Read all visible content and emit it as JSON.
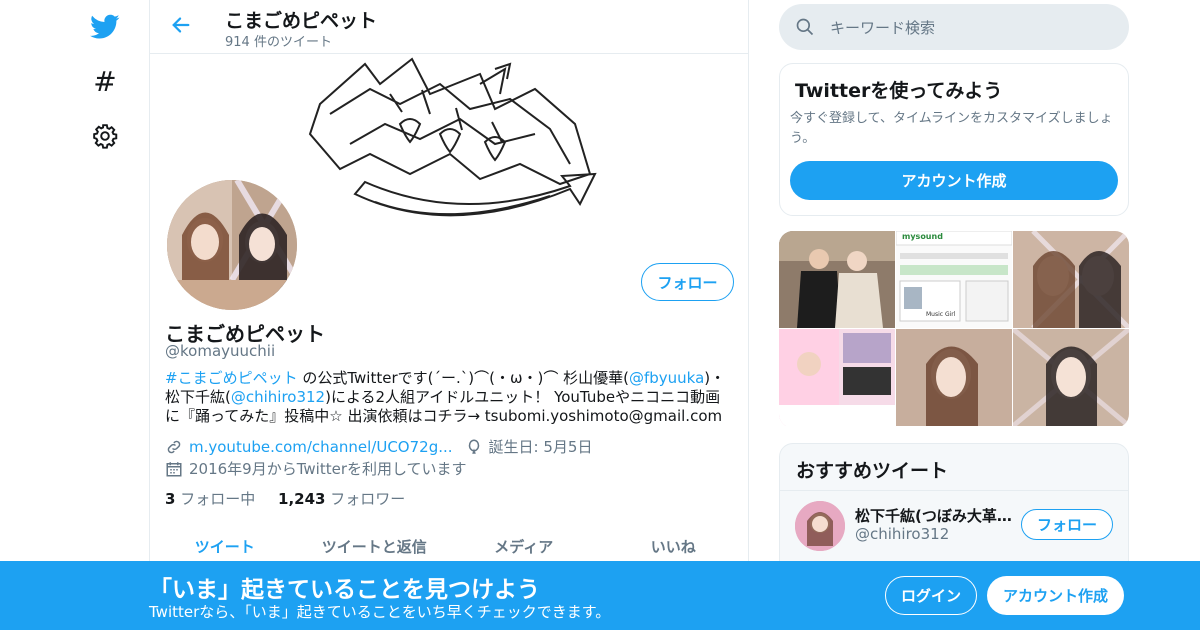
{
  "colors": {
    "accent": "#1da1f2",
    "muted": "#657786",
    "border": "#e6ecf0"
  },
  "nav": {
    "icons": [
      "twitter-bird-icon",
      "hashtag-icon",
      "gear-icon"
    ],
    "hashtag_glyph": "#"
  },
  "header": {
    "title": "こまごめピペット",
    "tweet_count": "914 件のツイート"
  },
  "profile": {
    "name": "こまごめピペット",
    "handle": "@komayuuchii",
    "follow_label": "フォロー",
    "bio": {
      "hashtag": "#こまごめピペット",
      "part1": " の公式Twitterです(´ー.`)⌒(・ω・)⌒ 杉山優華(",
      "mention1": "@fbyuuka",
      "part2": ")・松下千紘(",
      "mention2": "@chihiro312",
      "part3": ")による2人組アイドルユニット！ YouTubeやニコニコ動画に『踊ってみた』投稿中☆ 出演依頼はコチラ→ tsubomi.yoshimoto@gmail.com"
    },
    "website": "m.youtube.com/channel/UCO72g...",
    "birthday": "誕生日: 5月5日",
    "joined": "2016年9月からTwitterを利用しています",
    "following_count": "3",
    "following_label": "フォロー中",
    "followers_count": "1,243",
    "followers_label": "フォロワー"
  },
  "tabs": [
    {
      "label": "ツイート",
      "active": true
    },
    {
      "label": "ツイートと返信",
      "active": false
    },
    {
      "label": "メディア",
      "active": false
    },
    {
      "label": "いいね",
      "active": false
    }
  ],
  "search": {
    "placeholder": "キーワード検索"
  },
  "signup_card": {
    "title": "Twitterを使ってみよう",
    "description": "今すぐ登録して、タイムラインをカスタマイズしましょう。",
    "button": "アカウント作成"
  },
  "media_thumbs": {
    "mysound_label": "mysound",
    "music_girl_label": "Music Girl"
  },
  "recommended": {
    "title": "おすすめツイート",
    "items": [
      {
        "name": "松下千紘(つぼみ大革…",
        "handle": "@chihiro312",
        "button": "フォロー"
      }
    ]
  },
  "bottom_bar": {
    "title": "「いま」起きていることを見つけよう",
    "subtitle": "Twitterなら、「いま」起きていることをいち早くチェックできます。",
    "login": "ログイン",
    "signup": "アカウント作成"
  }
}
